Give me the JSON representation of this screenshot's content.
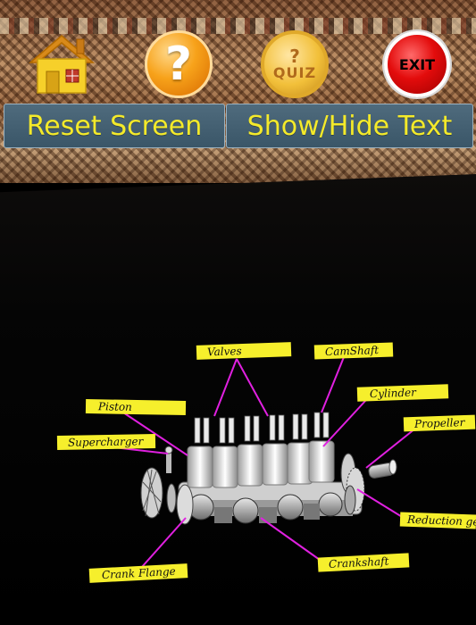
{
  "toolbar": {
    "home_icon": "home-icon",
    "help_icon": "question-mark-icon",
    "help_glyph": "?",
    "quiz_icon": "quiz-icon",
    "quiz_glyph": "?",
    "quiz_label": "QUIZ",
    "exit_label": "EXIT"
  },
  "actions": {
    "reset_label": "Reset Screen",
    "toggle_text_label": "Show/Hide Text"
  },
  "engine_labels": {
    "valves": "Valves",
    "camshaft": "CamShaft",
    "cylinder": "Cylinder",
    "piston": "Piston",
    "propeller": "Propeller",
    "supercharger": "Supercharger",
    "reduction_gear": "Reduction gear",
    "crank_flange": "Crank Flange",
    "crankshaft": "Crankshaft"
  },
  "colors": {
    "label_bg": "#f6ef2c",
    "leader_line": "#e020e0",
    "button_text": "#f4ea2a",
    "button_bg": "#45606f"
  }
}
